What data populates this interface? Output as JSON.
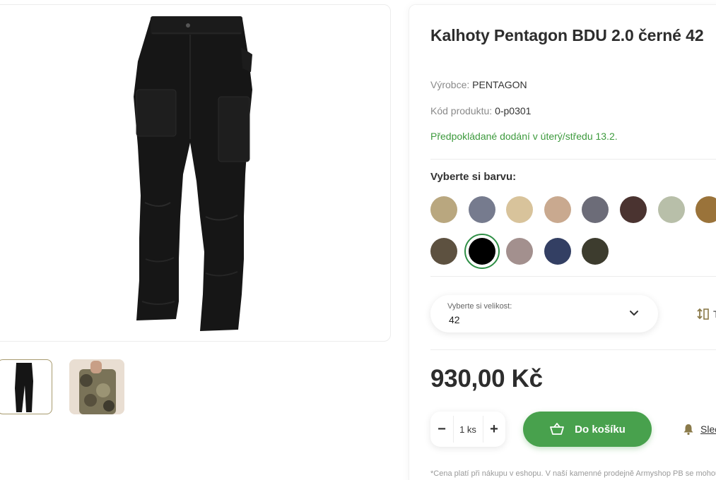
{
  "product": {
    "title": "Kalhoty Pentagon BDU 2.0 černé 42",
    "manufacturer_label": "Výrobce:",
    "manufacturer_value": "PENTAGON",
    "code_label": "Kód produktu:",
    "code_value": "0-p0301",
    "delivery": "Předpokládané dodání v úterý/středu 13.2."
  },
  "colors": {
    "label": "Vyberte si barvu:",
    "selected_index": 9,
    "swatches": [
      {
        "name": "multicam",
        "color": "#b9a77f"
      },
      {
        "name": "grey-blue",
        "color": "#767b8e"
      },
      {
        "name": "desert-camo",
        "color": "#d8c39b"
      },
      {
        "name": "tan",
        "color": "#c9a98f"
      },
      {
        "name": "wolf-grey",
        "color": "#6c6c78"
      },
      {
        "name": "brown",
        "color": "#4a3330"
      },
      {
        "name": "digital-camo",
        "color": "#b8bfa9"
      },
      {
        "name": "coyote",
        "color": "#9a733a"
      },
      {
        "name": "woodland-camo",
        "color": "#5d5140"
      },
      {
        "name": "black",
        "color": "#000000"
      },
      {
        "name": "urban-camo",
        "color": "#a3908e"
      },
      {
        "name": "navy",
        "color": "#333f63"
      },
      {
        "name": "olive",
        "color": "#3d3c2e"
      }
    ]
  },
  "size": {
    "label": "Vyberte si velikost:",
    "value": "42",
    "guide_text": "T"
  },
  "price": "930,00 Kč",
  "quantity": {
    "minus": "−",
    "plus": "+",
    "value": "1 ks"
  },
  "cart_button": "Do košíku",
  "watch_link": "Sled",
  "footnote": "*Cena platí při nákupu v eshopu. V naší kamenné prodejně Armyshop PB se mohou",
  "accent_color": "#48a14d"
}
